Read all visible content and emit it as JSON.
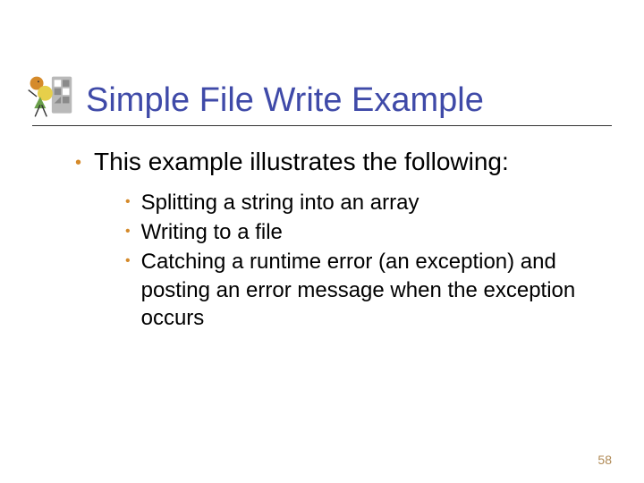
{
  "slide": {
    "title": "Simple File Write Example",
    "bullets_l1": [
      "This example illustrates the following:"
    ],
    "bullets_l2": [
      "Splitting a string into an array",
      "Writing to a file",
      "Catching a runtime error (an exception) and posting an error message when the exception occurs"
    ],
    "page_number": "58"
  }
}
